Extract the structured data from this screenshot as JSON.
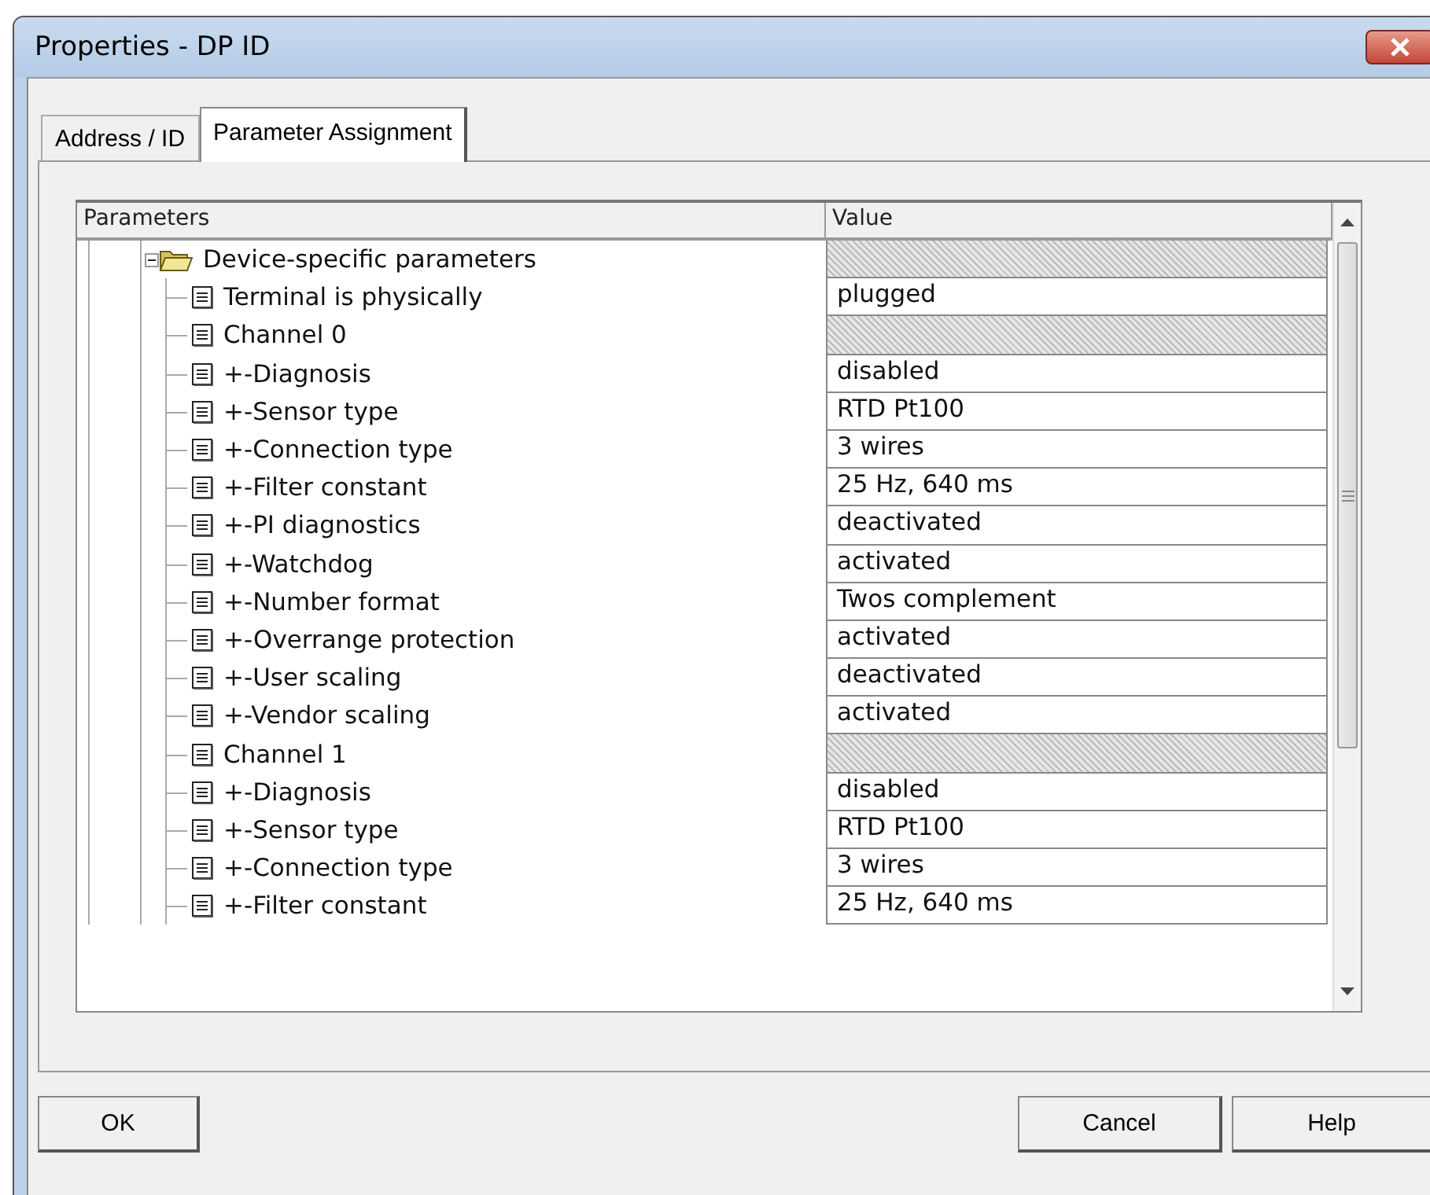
{
  "window": {
    "title": "Properties - DP ID"
  },
  "tabs": [
    {
      "label": "Address / ID",
      "selected": false
    },
    {
      "label": "Parameter Assignment",
      "selected": true
    }
  ],
  "table": {
    "columns": [
      "Parameters",
      "Value"
    ],
    "tree": [
      {
        "label": "Device-specific parameters",
        "kind": "folder",
        "expanded": true,
        "children": [
          {
            "label": "Terminal is physically",
            "kind": "param",
            "value": "plugged"
          },
          {
            "label": "Channel 0",
            "kind": "group"
          },
          {
            "label": "+-Diagnosis",
            "kind": "param",
            "value": "disabled"
          },
          {
            "label": "+-Sensor type",
            "kind": "param",
            "value": "RTD Pt100"
          },
          {
            "label": "+-Connection type",
            "kind": "param",
            "value": "3 wires"
          },
          {
            "label": "+-Filter constant",
            "kind": "param",
            "value": "25 Hz, 640 ms"
          },
          {
            "label": "+-PI diagnostics",
            "kind": "param",
            "value": "deactivated"
          },
          {
            "label": "+-Watchdog",
            "kind": "param",
            "value": "activated"
          },
          {
            "label": "+-Number format",
            "kind": "param",
            "value": "Twos complement"
          },
          {
            "label": "+-Overrange protection",
            "kind": "param",
            "value": "activated"
          },
          {
            "label": "+-User scaling",
            "kind": "param",
            "value": "deactivated"
          },
          {
            "label": "+-Vendor scaling",
            "kind": "param",
            "value": "activated"
          },
          {
            "label": "Channel 1",
            "kind": "group"
          },
          {
            "label": "+-Diagnosis",
            "kind": "param",
            "value": "disabled"
          },
          {
            "label": "+-Sensor type",
            "kind": "param",
            "value": "RTD Pt100"
          },
          {
            "label": "+-Connection type",
            "kind": "param",
            "value": "3 wires"
          },
          {
            "label": "+-Filter constant",
            "kind": "param",
            "value": "25 Hz, 640 ms"
          }
        ]
      }
    ]
  },
  "buttons": [
    {
      "label": "OK",
      "kind": "left"
    },
    {
      "label": "Cancel",
      "kind": "right"
    },
    {
      "label": "Help",
      "kind": "right"
    }
  ]
}
